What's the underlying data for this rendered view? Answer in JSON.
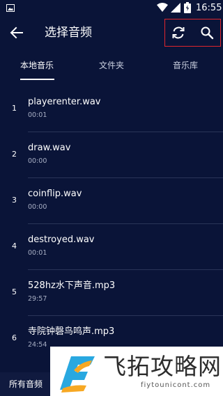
{
  "status_bar": {
    "time": "16:55",
    "icons": [
      "image-icon",
      "wifi-icon",
      "signal-icon",
      "battery-icon"
    ]
  },
  "toolbar": {
    "title": "选择音频",
    "back_icon": "back-arrow-icon",
    "refresh_icon": "refresh-icon",
    "search_icon": "search-icon",
    "highlight_color": "#e0262d"
  },
  "tabs": [
    {
      "label": "本地音乐",
      "active": true
    },
    {
      "label": "文件夹",
      "active": false
    },
    {
      "label": "音乐库",
      "active": false
    }
  ],
  "tracks": [
    {
      "index": "1",
      "name": "playerenter.wav",
      "duration": "00:01"
    },
    {
      "index": "2",
      "name": "draw.wav",
      "duration": "00:00"
    },
    {
      "index": "3",
      "name": "coinflip.wav",
      "duration": "00:00"
    },
    {
      "index": "4",
      "name": "destroyed.wav",
      "duration": "00:01"
    },
    {
      "index": "5",
      "name": "528hz水下声音.mp3",
      "duration": "29:57"
    },
    {
      "index": "6",
      "name": "寺院钟磬鸟鸣声.mp3",
      "duration": "24:54"
    }
  ],
  "bottom_bar": {
    "all_audio_label": "所有音频"
  },
  "watermark": {
    "text": "飞拓攻略网",
    "domain": "fiytounicont.com"
  },
  "colors": {
    "background": "#0a1438",
    "text_primary": "#ffffff",
    "text_secondary": "#a8afc4",
    "divider": "#2a3558"
  }
}
